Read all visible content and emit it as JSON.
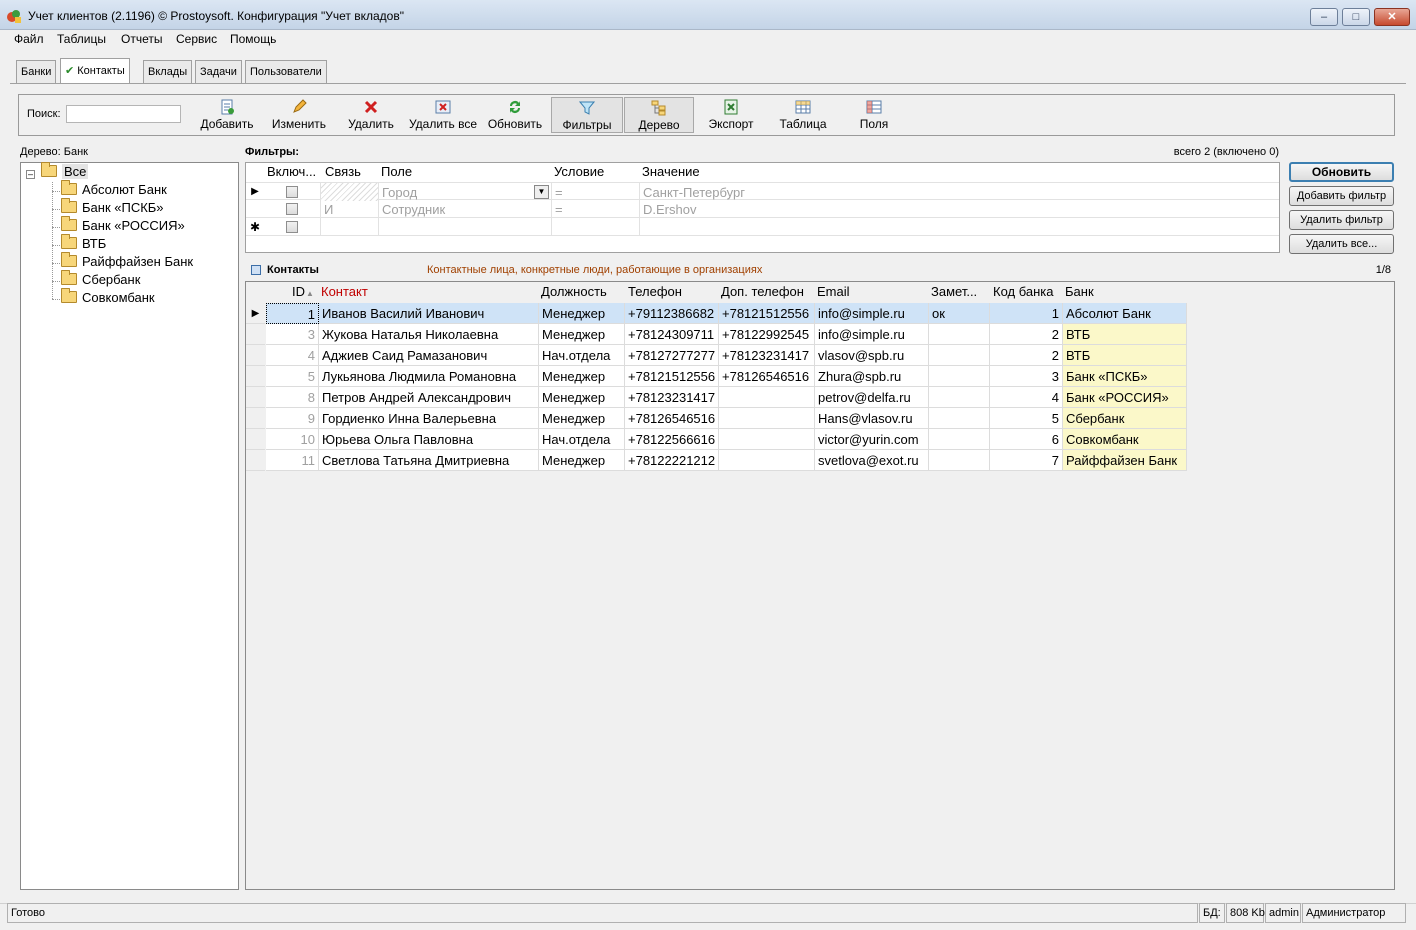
{
  "window": {
    "title": "Учет клиентов (2.1196) © Prostoysoft. Конфигурация \"Учет вкладов\"",
    "controls": {
      "minimize": "–",
      "maximize": "□",
      "close": "✕"
    }
  },
  "menu": [
    "Файл",
    "Таблицы",
    "Отчеты",
    "Сервис",
    "Помощь"
  ],
  "tabs": [
    {
      "label": "Банки",
      "active": false
    },
    {
      "label": "Контакты",
      "active": true,
      "check": "✔"
    },
    {
      "label": "Вклады",
      "active": false
    },
    {
      "label": "Задачи",
      "active": false
    },
    {
      "label": "Пользователи",
      "active": false
    }
  ],
  "toolbar": {
    "search_label": "Поиск:",
    "search_value": "",
    "buttons": [
      {
        "label": "Добавить",
        "icon": "add-doc-icon"
      },
      {
        "label": "Изменить",
        "icon": "pencil-icon"
      },
      {
        "label": "Удалить",
        "icon": "delete-x-icon"
      },
      {
        "label": "Удалить все",
        "icon": "delete-all-icon"
      },
      {
        "label": "Обновить",
        "icon": "refresh-icon"
      },
      {
        "label": "Фильтры",
        "icon": "filter-icon",
        "pressed": true
      },
      {
        "label": "Дерево",
        "icon": "tree-icon",
        "pressed": true
      },
      {
        "label": "Экспорт",
        "icon": "excel-export-icon"
      },
      {
        "label": "Таблица",
        "icon": "table-icon"
      },
      {
        "label": "Поля",
        "icon": "fields-icon"
      }
    ]
  },
  "tree": {
    "label": "Дерево: Банк",
    "expander": "–",
    "root": "Все",
    "children": [
      "Абсолют Банк",
      "Банк «ПСКБ»",
      "Банк «РОССИЯ»",
      "ВТБ",
      "Райффайзен Банк",
      "Сбербанк",
      "Совкомбанк"
    ]
  },
  "filters": {
    "title": "Фильтры:",
    "count": "всего 2 (включено 0)",
    "columns": [
      "Включ...",
      "Связь",
      "Поле",
      "Условие",
      "Значение"
    ],
    "rows": [
      {
        "link": "",
        "field": "Город",
        "condition": "=",
        "value": "Санкт-Петербург"
      },
      {
        "link": "И",
        "field": "Сотрудник",
        "condition": "=",
        "value": "D.Ershov"
      }
    ],
    "new_row_marker": "✱",
    "buttons": [
      "Обновить",
      "Добавить фильтр",
      "Удалить фильтр",
      "Удалить все..."
    ]
  },
  "contacts": {
    "title": "Контакты",
    "description": "Контактные лица, конкретные люди, работающие в организациях",
    "page": "1/8",
    "columns": [
      "ID",
      "Контакт",
      "Должность",
      "Телефон",
      "Доп. телефон",
      "Email",
      "Замет...",
      "Код банка",
      "Банк"
    ],
    "sort_arrow": "▲",
    "rows": [
      {
        "id": "1",
        "name": "Иванов Василий Иванович",
        "position": "Менеджер",
        "phone": "+79112386682",
        "phone2": "+78121512556",
        "email": "info@simple.ru",
        "note": "ок",
        "bank_code": "1",
        "bank": "Абсолют Банк"
      },
      {
        "id": "3",
        "name": "Жукова Наталья Николаевна",
        "position": "Менеджер",
        "phone": "+78124309711",
        "phone2": "+78122992545",
        "email": "info@simple.ru",
        "note": "",
        "bank_code": "2",
        "bank": "ВТБ"
      },
      {
        "id": "4",
        "name": "Аджиев Саид Рамазанович",
        "position": "Нач.отдела",
        "phone": "+78127277277",
        "phone2": "+78123231417",
        "email": "vlasov@spb.ru",
        "note": "",
        "bank_code": "2",
        "bank": "ВТБ"
      },
      {
        "id": "5",
        "name": "Лукьянова Людмила Романовна",
        "position": "Менеджер",
        "phone": "+78121512556",
        "phone2": "+78126546516",
        "email": "Zhura@spb.ru",
        "note": "",
        "bank_code": "3",
        "bank": "Банк «ПСКБ»"
      },
      {
        "id": "8",
        "name": "Петров Андрей Александрович",
        "position": "Менеджер",
        "phone": "+78123231417",
        "phone2": "",
        "email": "petrov@delfa.ru",
        "note": "",
        "bank_code": "4",
        "bank": "Банк «РОССИЯ»"
      },
      {
        "id": "9",
        "name": "Гордиенко Инна Валерьевна",
        "position": "Менеджер",
        "phone": "+78126546516",
        "phone2": "",
        "email": "Hans@vlasov.ru",
        "note": "",
        "bank_code": "5",
        "bank": "Сбербанк"
      },
      {
        "id": "10",
        "name": "Юрьева Ольга Павловна",
        "position": "Нач.отдела",
        "phone": "+78122566616",
        "phone2": "",
        "email": "victor@yurin.com",
        "note": "",
        "bank_code": "6",
        "bank": "Совкомбанк"
      },
      {
        "id": "11",
        "name": "Светлова Татьяна Дмитриевна",
        "position": "Менеджер",
        "phone": "+78122221212",
        "phone2": "",
        "email": "svetlova@exot.ru",
        "note": "",
        "bank_code": "7",
        "bank": "Райффайзен Банк"
      }
    ]
  },
  "status": {
    "left": "Готово",
    "db_label": "БД:",
    "db_size": "808 Kb",
    "user": "admin",
    "role": "Администратор"
  },
  "colors": {
    "selected_row": "#cfe3f7",
    "bank_column": "#fbf8c9",
    "contact_header": "#c00000",
    "description": "#a04000"
  }
}
